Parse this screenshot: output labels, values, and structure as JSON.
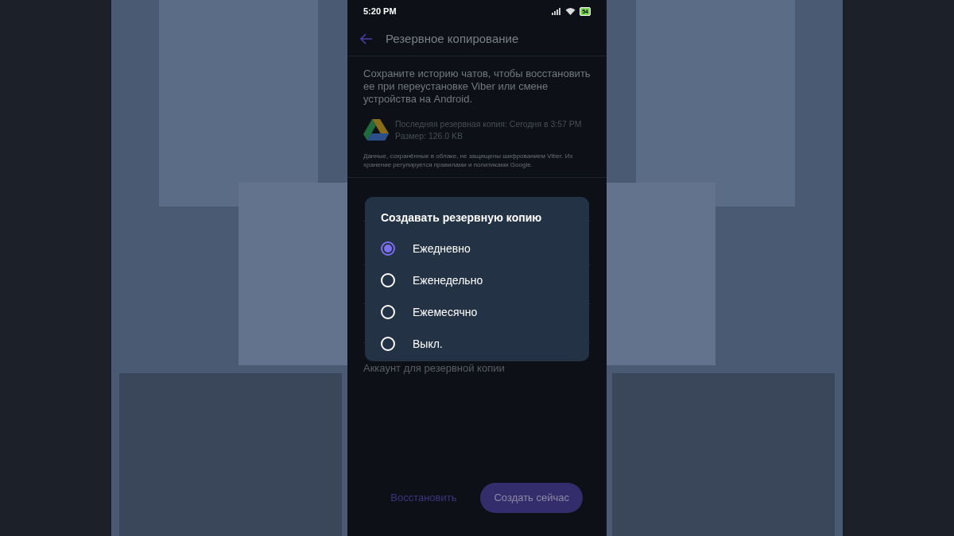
{
  "status_bar": {
    "time": "5:20 PM",
    "battery": "54"
  },
  "header": {
    "title": "Резервное копирование"
  },
  "description": "Сохраните историю чатов, чтобы восстановить ее при переустановке Viber или смене устройства на Android.",
  "backup_info": {
    "last_backup": "Последняя резервная копия: Сегодня в 3:57 PM",
    "size": "Размер: 126.0 KB"
  },
  "cloud_note": "Данные, сохранённые в облаке, не защищены шифрованием Viber. Их хранение регулируется правилами и политиками Google.",
  "settings_rows": [
    {
      "kind": "blank"
    },
    {
      "kind": "blank"
    },
    {
      "kind": "blank"
    },
    {
      "kind": "blank"
    },
    {
      "kind": "text",
      "label": "Аккаунт для резервной копии"
    }
  ],
  "dialog": {
    "title": "Создавать резервную копию",
    "options": [
      {
        "label": "Ежедневно",
        "selected": true
      },
      {
        "label": "Еженедельно",
        "selected": false
      },
      {
        "label": "Ежемесячно",
        "selected": false
      },
      {
        "label": "Выкл.",
        "selected": false
      }
    ]
  },
  "buttons": {
    "restore": "Восстановить",
    "create": "Создать сейчас"
  }
}
